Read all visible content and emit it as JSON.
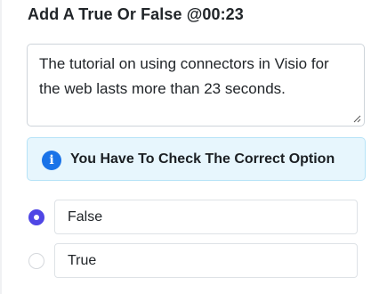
{
  "question": {
    "title": "Add A True Or False @00:23",
    "statement": "The tutorial on using connectors in Visio for the web lasts more than 23 seconds."
  },
  "alert": {
    "icon": "info-icon",
    "text": "You Have To Check The Correct Option"
  },
  "options": [
    {
      "label": "False",
      "selected": true
    },
    {
      "label": "True",
      "selected": false
    }
  ],
  "colors": {
    "radio_selected": "#4f46e5",
    "alert_bg": "#e7f6fd",
    "info_icon": "#1a73e8"
  }
}
